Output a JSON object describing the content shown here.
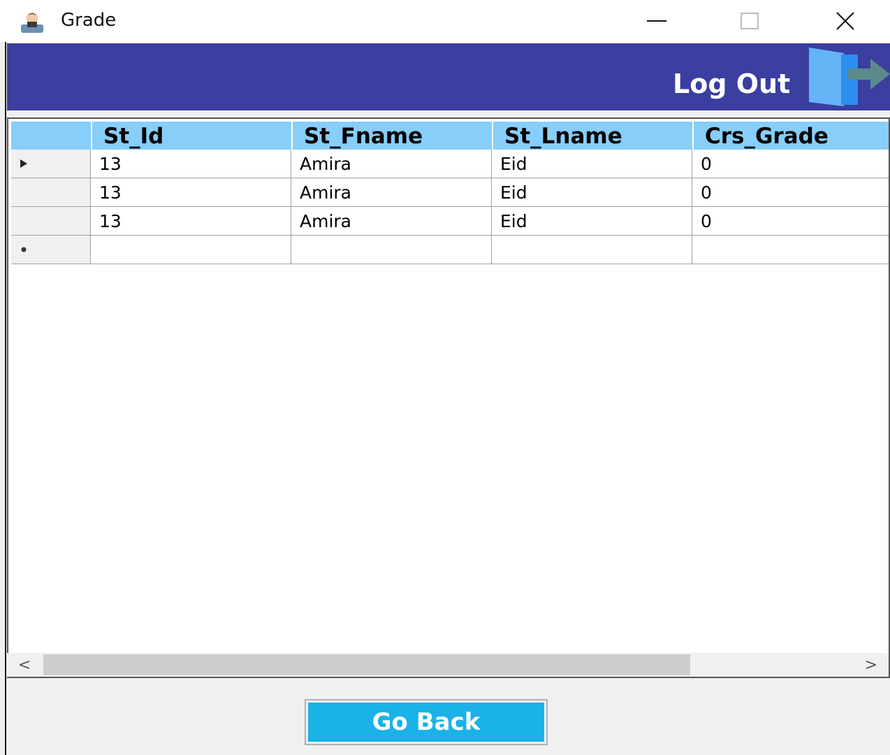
{
  "window": {
    "title": "Grade",
    "icon": "user-avatar-icon",
    "controls": [
      "minimize-icon",
      "maximize-icon",
      "close-icon"
    ]
  },
  "header": {
    "logout_label": "Log Out",
    "logout_icon": "door-exit-icon",
    "color": "#3a3fa0"
  },
  "grid": {
    "columns": [
      "St_Id",
      "St_Fname",
      "St_Lname",
      "Crs_Grade"
    ],
    "header_color": "#87cefa",
    "rows": [
      {
        "indicator": "current-row-arrow-icon",
        "cells": [
          "13",
          "Amira",
          "Eid",
          "0"
        ]
      },
      {
        "indicator": "",
        "cells": [
          "13",
          "Amira",
          "Eid",
          "0"
        ]
      },
      {
        "indicator": "",
        "cells": [
          "13",
          "Amira",
          "Eid",
          "0"
        ]
      },
      {
        "indicator": "new-row-star-icon",
        "cells": [
          "",
          "",
          "",
          ""
        ]
      }
    ]
  },
  "footer": {
    "go_back_label": "Go Back",
    "button_color": "#1ab2e8"
  }
}
